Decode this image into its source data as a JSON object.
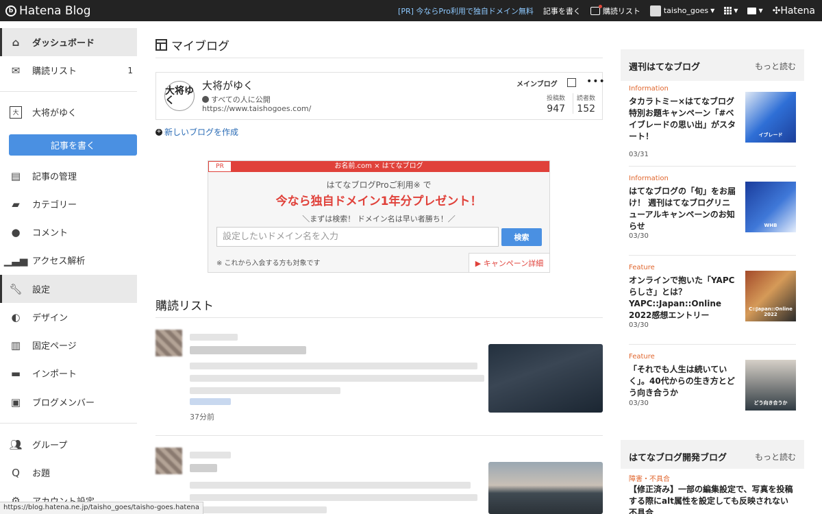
{
  "topbar": {
    "logo": "Hatena Blog",
    "pr_link": "[PR] 今ならPro利用で独自ドメイン無料",
    "write": "記事を書く",
    "subscriptions": "購読リスト",
    "user": "taisho_goes",
    "brand": "Hatena"
  },
  "sidebar": {
    "dashboard": "ダッシュボード",
    "subscriptions": "購読リスト",
    "subscriptions_count": "1",
    "blog_name": "大将がゆく",
    "write_button": "記事を書く",
    "items": [
      "記事の管理",
      "カテゴリー",
      "コメント",
      "アクセス解析",
      "設定",
      "デザイン",
      "固定ページ",
      "インポート",
      "ブログメンバー"
    ],
    "bottom_items": [
      "グループ",
      "お題",
      "アカウント設定"
    ]
  },
  "main": {
    "heading": "マイブログ",
    "blog": {
      "logo_text": "大将ゆく",
      "title": "大将がゆく",
      "visibility": "すべての人に公開",
      "url": "https://www.taishogoes.com/",
      "main_label": "メインブログ",
      "posts_label": "投稿数",
      "posts": "947",
      "readers_label": "読者数",
      "readers": "152"
    },
    "new_blog": "新しいブログを作成",
    "ad": {
      "pr": "PR",
      "bar": "お名前.com × はてなブログ",
      "line1": "はてなブログProご利用※ で",
      "headline": "今なら独自ドメイン1年分プレゼント！",
      "line2": "＼まずは検索！ ドメイン名は早い者勝ち！／",
      "placeholder": "設定したいドメイン名を入力",
      "search": "検索",
      "note": "※ これから入会する方も対象です",
      "campaign": "▶ キャンペーン詳細"
    },
    "feed_title": "購読リスト",
    "feed_time": "37分前"
  },
  "status_url": "https://blog.hatena.ne.jp/taisho_goes/taisho-goes.hatena",
  "weekly": {
    "title": "週刊はてなブログ",
    "more": "もっと読む",
    "items": [
      {
        "category": "Information",
        "title": "タカラトミー×はてなブログ 特別お題キャンペーン「#ベイブレードの思い出」がスタート！",
        "date": "03/31",
        "thumb_caption": "イブレード"
      },
      {
        "category": "Information",
        "title": "はてなブログの「旬」をお届け！ 週刊はてなブログリニューアルキャンペーンのお知らせ",
        "date": "03/30",
        "thumb_caption": "WHB"
      },
      {
        "category": "Feature",
        "title": "オンラインで抱いた「YAPCらしさ」とは？ YAPC::Japan::Online 2022感想エントリー",
        "date": "03/30",
        "thumb_caption": "C::Japan::Online 2022"
      },
      {
        "category": "Feature",
        "title": "「それでも人生は続いていく」。40代からの生き方とどう向き合うか",
        "date": "03/30",
        "thumb_caption": "どう向き合うか"
      }
    ]
  },
  "dev": {
    "title": "はてなブログ開発ブログ",
    "more": "もっと読む",
    "category": "障害・不具合",
    "entry": "【修正済み】一部の編集設定で、写真を投稿する際にalt属性を設定しても反映されない不具合"
  }
}
